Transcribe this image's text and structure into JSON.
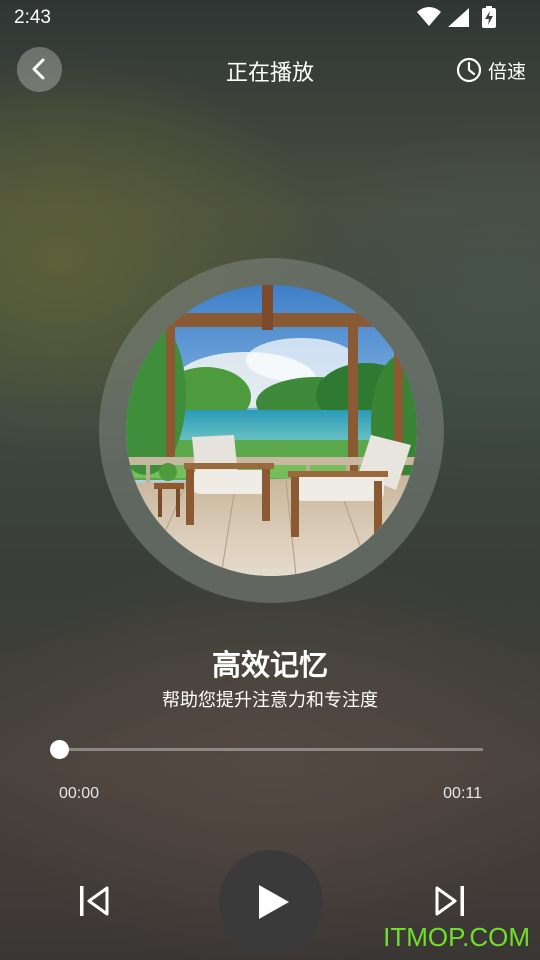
{
  "status_bar": {
    "time": "2:43",
    "icons": [
      "wifi-icon",
      "cellular-signal-icon",
      "battery-charging-icon"
    ]
  },
  "header": {
    "back_icon": "chevron-left-icon",
    "title": "正在播放",
    "speed_icon": "clock-icon",
    "speed_label": "倍速"
  },
  "track": {
    "cover_art": "watercolor-porch-lake-artwork",
    "title": "高效记忆",
    "subtitle": "帮助您提升注意力和专注度"
  },
  "progress": {
    "current_time": "00:00",
    "total_time": "00:11",
    "fraction": 0.0
  },
  "controls": {
    "previous_icon": "skip-previous-icon",
    "play_icon": "play-icon",
    "next_icon": "skip-next-icon"
  },
  "watermark": {
    "text": "ITMOP.COM",
    "color": "#6fe02a"
  }
}
